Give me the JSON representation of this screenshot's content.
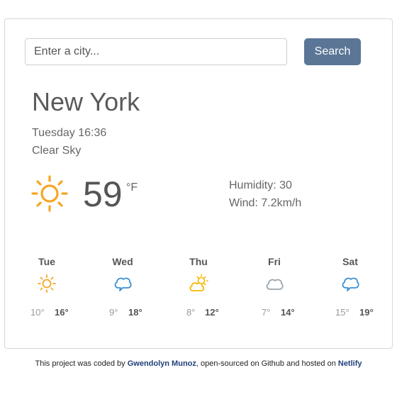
{
  "search": {
    "placeholder": "Enter a city...",
    "button_label": "Search"
  },
  "current": {
    "city": "New York",
    "datetime": "Tuesday 16:36",
    "description": "Clear Sky",
    "icon": "sun-icon",
    "temperature": "59",
    "unit": "°F",
    "humidity": "Humidity: 30",
    "wind": "Wind: 7.2km/h"
  },
  "forecast": [
    {
      "day": "Tue",
      "icon": "sun-icon",
      "min": "10°",
      "max": "16°"
    },
    {
      "day": "Wed",
      "icon": "cloud-icon",
      "min": "9°",
      "max": "18°"
    },
    {
      "day": "Thu",
      "icon": "partly-cloudy-icon",
      "min": "8°",
      "max": "12°"
    },
    {
      "day": "Fri",
      "icon": "cloud-icon",
      "min": "7°",
      "max": "14°"
    },
    {
      "day": "Sat",
      "icon": "cloud-icon",
      "min": "15°",
      "max": "19°"
    }
  ],
  "footer": {
    "prefix": "This project was coded by ",
    "author": "Gwendolyn Munoz",
    "middle": ", open-sourced on Github and hosted on ",
    "host": "Netlify"
  },
  "colors": {
    "accent": "#5b7596",
    "sun": "#f5a623",
    "cloud_blue": "#3a8fd6",
    "cloud_gray": "#9aa4ad",
    "link": "#1f3f78"
  }
}
